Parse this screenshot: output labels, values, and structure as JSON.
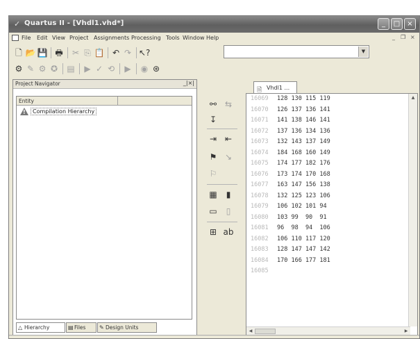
{
  "window": {
    "title": "Quartus II - [Vhdl1.vhd*]",
    "controls": {
      "minimize": "_",
      "maximize": "□",
      "close": "×"
    }
  },
  "menu": {
    "items": [
      "File",
      "Edit",
      "View",
      "Project",
      "Assignments",
      "Processing",
      "Tools",
      "Window",
      "Help"
    ],
    "mdi_controls": {
      "minimize": "_",
      "restore": "❐",
      "close": "×"
    }
  },
  "toolbar": {
    "combo_value": "",
    "combo_arrow": "▼"
  },
  "navigator": {
    "title": "Project Navigator",
    "close_label": "_|×|",
    "column_header": "Entity",
    "tree_item": "Compilation Hierarchy",
    "tabs": [
      "Hierarchy",
      "Files",
      "Design Units"
    ]
  },
  "editor": {
    "tab_label": "Vhdl1 ...",
    "lines": [
      {
        "n": "16069",
        "v": "128 130 115 119"
      },
      {
        "n": "16070",
        "v": "126 137 136 141"
      },
      {
        "n": "16071",
        "v": "141 138 146 141"
      },
      {
        "n": "16072",
        "v": "137 136 134 136"
      },
      {
        "n": "16073",
        "v": "132 143 137 149"
      },
      {
        "n": "16074",
        "v": "184 168 160 149"
      },
      {
        "n": "16075",
        "v": "174 177 182 176"
      },
      {
        "n": "16076",
        "v": "173 174 170 168"
      },
      {
        "n": "16077",
        "v": "163 147 156 138"
      },
      {
        "n": "16078",
        "v": "132 125 123 106"
      },
      {
        "n": "16079",
        "v": "106 102 101 94"
      },
      {
        "n": "16080",
        "v": "103 99  90  91"
      },
      {
        "n": "16081",
        "v": "96  98  94  106"
      },
      {
        "n": "16082",
        "v": "106 110 117 120"
      },
      {
        "n": "16083",
        "v": "128 147 147 142"
      },
      {
        "n": "16084",
        "v": "170 166 177 181"
      },
      {
        "n": "16085",
        "v": ""
      }
    ]
  }
}
